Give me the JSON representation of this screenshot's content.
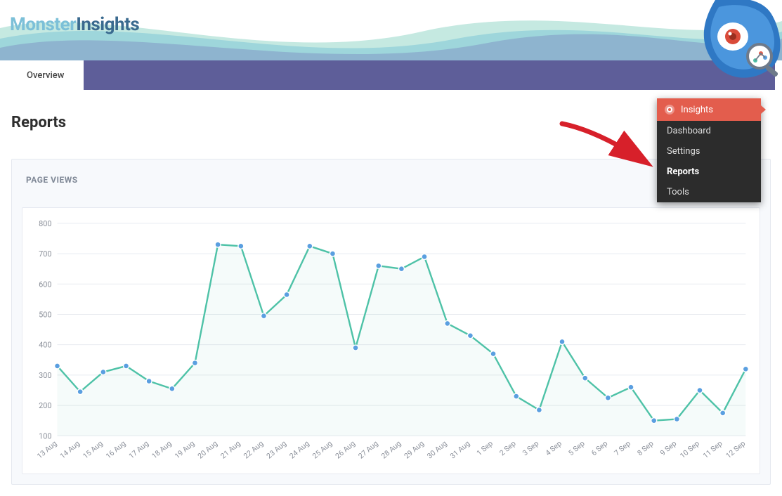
{
  "brand": {
    "part1": "Monster",
    "part2": "Insights"
  },
  "tabs": [
    {
      "label": "Overview",
      "active": true
    }
  ],
  "page_title": "Reports",
  "panel_title": "PAGE VIEWS",
  "sidemenu": {
    "header_icon": "insights-mascot-icon",
    "header": "Insights",
    "items": [
      {
        "label": "Dashboard",
        "active": false
      },
      {
        "label": "Settings",
        "active": false
      },
      {
        "label": "Reports",
        "active": true
      },
      {
        "label": "Tools",
        "active": false
      }
    ]
  },
  "annotation_arrow_color": "#d7202a",
  "colors": {
    "tabbar": "#5e5e99",
    "menu_header": "#e35d4d",
    "line": "#4ec2a7",
    "point": "#5a9fe0"
  },
  "chart_data": {
    "type": "line",
    "title": "PAGE VIEWS",
    "xlabel": "",
    "ylabel": "",
    "ylim": [
      100,
      800
    ],
    "yticks": [
      100,
      200,
      300,
      400,
      500,
      600,
      700,
      800
    ],
    "categories": [
      "13 Aug",
      "14 Aug",
      "15 Aug",
      "16 Aug",
      "17 Aug",
      "18 Aug",
      "19 Aug",
      "20 Aug",
      "21 Aug",
      "22 Aug",
      "23 Aug",
      "24 Aug",
      "25 Aug",
      "26 Aug",
      "27 Aug",
      "28 Aug",
      "29 Aug",
      "30 Aug",
      "31 Aug",
      "1 Sep",
      "2 Sep",
      "3 Sep",
      "4 Sep",
      "5 Sep",
      "6 Sep",
      "7 Sep",
      "8 Sep",
      "9 Sep",
      "10 Sep",
      "11 Sep",
      "12 Sep"
    ],
    "values": [
      330,
      245,
      310,
      330,
      280,
      255,
      340,
      730,
      725,
      495,
      565,
      725,
      700,
      390,
      660,
      650,
      690,
      470,
      430,
      370,
      230,
      185,
      410,
      290,
      225,
      260,
      150,
      155,
      250,
      175,
      320
    ]
  }
}
